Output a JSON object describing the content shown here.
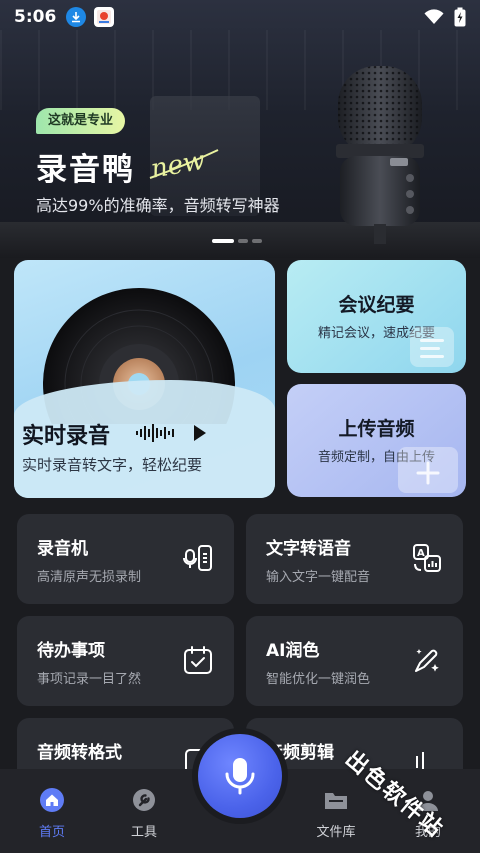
{
  "status_bar": {
    "time": "5:06",
    "icons": [
      "download-icon",
      "app-notification-icon",
      "wifi-icon",
      "battery-charging-icon"
    ]
  },
  "banner": {
    "tag": "这就是专业",
    "title": "录音鸭",
    "title_script": "new",
    "subtitle": "高达99%的准确率，音频转写神器",
    "slides_total": 3,
    "active_slide": 1
  },
  "features": {
    "realtime": {
      "title": "实时录音",
      "subtitle": "实时录音转文字，轻松纪要"
    },
    "meeting": {
      "title": "会议纪要",
      "subtitle": "精记会议，速成纪要"
    },
    "upload": {
      "title": "上传音频",
      "subtitle": "音频定制，自由上传"
    }
  },
  "tools": [
    {
      "title": "录音机",
      "subtitle": "高清原声无损录制",
      "icon": "recorder-icon"
    },
    {
      "title": "文字转语音",
      "subtitle": "输入文字一键配音",
      "icon": "text-to-speech-icon"
    },
    {
      "title": "待办事项",
      "subtitle": "事项记录一目了然",
      "icon": "calendar-check-icon"
    },
    {
      "title": "AI润色",
      "subtitle": "智能优化一键润色",
      "icon": "magic-pen-icon"
    },
    {
      "title": "音频转格式",
      "subtitle": "",
      "icon": "format-convert-icon"
    },
    {
      "title": "音频剪辑",
      "subtitle": "",
      "icon": "audio-cut-icon"
    }
  ],
  "bottom_nav": {
    "items": [
      {
        "label": "首页",
        "icon": "home-icon",
        "active": true
      },
      {
        "label": "工具",
        "icon": "wrench-icon",
        "active": false
      },
      {
        "label": "文件库",
        "icon": "folder-icon",
        "active": false
      },
      {
        "label": "我的",
        "icon": "user-icon",
        "active": false
      }
    ],
    "center_action_icon": "microphone-icon"
  },
  "watermark": "出色软件站",
  "colors": {
    "accent": "#4b63ea",
    "active_tab": "#5f7cf5",
    "background": "#1b1c20",
    "tool_card": "#2b2d33"
  }
}
